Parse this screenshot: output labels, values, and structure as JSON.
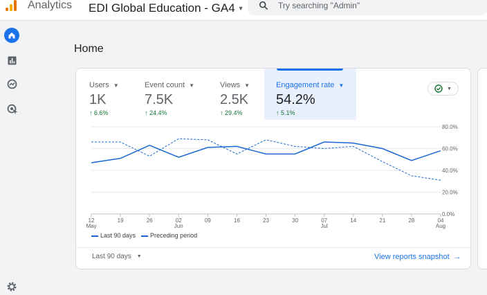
{
  "header": {
    "app_name": "Analytics",
    "property_name": "EDI Global Education - GA4",
    "search_placeholder": "Try searching \"Admin\""
  },
  "rail": {
    "items": [
      "home-icon",
      "reports-icon",
      "explore-icon",
      "advertising-icon"
    ],
    "settings_icon": "gear-icon"
  },
  "page": {
    "title": "Home"
  },
  "metrics": [
    {
      "label": "Users",
      "value": "1K",
      "delta": "6.6%",
      "active": false
    },
    {
      "label": "Event count",
      "value": "7.5K",
      "delta": "24.4%",
      "active": false
    },
    {
      "label": "Views",
      "value": "2.5K",
      "delta": "29.4%",
      "active": false
    },
    {
      "label": "Engagement rate",
      "value": "54.2%",
      "delta": "5.1%",
      "active": true
    }
  ],
  "colors": {
    "accent": "#1a73e8",
    "positive": "#137333",
    "series": "#1967d2"
  },
  "chart_data": {
    "type": "line",
    "x": [
      "12 May",
      "19",
      "26",
      "02 Jun",
      "09",
      "16",
      "23",
      "30",
      "07 Jul",
      "14",
      "21",
      "28",
      "04 Aug"
    ],
    "x_tick_top": [
      "12",
      "19",
      "26",
      "02",
      "09",
      "16",
      "23",
      "30",
      "07",
      "14",
      "21",
      "28",
      "04"
    ],
    "x_tick_bottom": [
      "May",
      "",
      "",
      "Jun",
      "",
      "",
      "",
      "",
      "Jul",
      "",
      "",
      "",
      "Aug"
    ],
    "y_ticks": [
      "80.0%",
      "60.0%",
      "40.0%",
      "20.0%",
      "0.0%"
    ],
    "ylim": [
      0,
      80
    ],
    "grid": true,
    "series": [
      {
        "name": "Last 90 days",
        "style": "solid",
        "values": [
          47,
          51,
          63,
          52,
          61,
          62,
          55,
          55,
          66,
          65,
          60,
          49,
          58
        ]
      },
      {
        "name": "Preceding period",
        "style": "dashed",
        "values": [
          66,
          66,
          53,
          69,
          68,
          55,
          68,
          62,
          60,
          62,
          48,
          35,
          31
        ]
      }
    ]
  },
  "footer": {
    "range_label": "Last 90 days",
    "snapshot_label": "View reports snapshot"
  }
}
